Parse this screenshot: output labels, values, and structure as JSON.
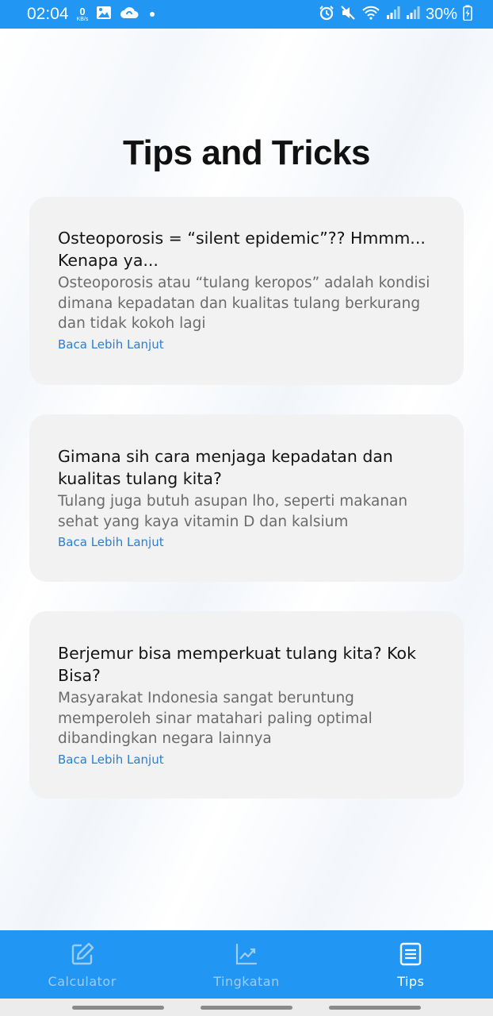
{
  "status_bar": {
    "time": "02:04",
    "net_speed_value": "0",
    "net_speed_unit": "KB/s",
    "battery": "30%",
    "color": "#2196f3"
  },
  "page": {
    "title": "Tips and Tricks"
  },
  "cards": [
    {
      "title": "Osteoporosis = “silent epidemic”?? Hmmm... Kenapa ya...",
      "description": "Osteoporosis atau “tulang keropos” adalah kondisi dimana kepadatan dan kualitas tulang berkurang dan tidak kokoh lagi",
      "link": "Baca Lebih Lanjut"
    },
    {
      "title": "Gimana sih cara menjaga kepadatan dan kualitas tulang kita?",
      "description": "Tulang juga butuh asupan lho, seperti makanan sehat yang kaya vitamin D dan kalsium",
      "link": "Baca Lebih Lanjut"
    },
    {
      "title": "Berjemur bisa memperkuat tulang kita? Kok Bisa?",
      "description": "Masyarakat Indonesia sangat beruntung memperoleh sinar matahari paling optimal dibandingkan negara lainnya",
      "link": "Baca Lebih Lanjut"
    }
  ],
  "bottom_nav": {
    "items": [
      {
        "label": "Calculator",
        "icon": "edit-icon",
        "active": false
      },
      {
        "label": "Tingkatan",
        "icon": "trending-up-icon",
        "active": false
      },
      {
        "label": "Tips",
        "icon": "list-icon",
        "active": true
      }
    ],
    "color": "#2196f3"
  }
}
